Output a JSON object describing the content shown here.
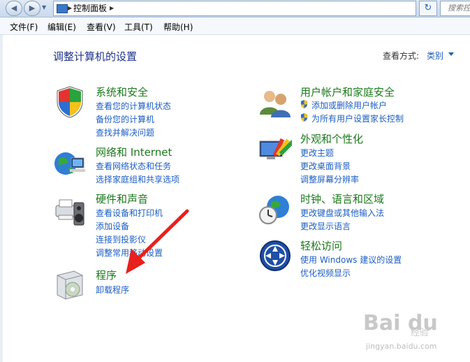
{
  "address": {
    "crumb": "控制面板",
    "search_placeholder": "搜索控"
  },
  "menu": [
    "文件(F)",
    "编辑(E)",
    "查看(V)",
    "工具(T)",
    "帮助(H)"
  ],
  "page": {
    "title": "调整计算机的设置",
    "view_by_label": "查看方式:",
    "view_by_value": "类别"
  },
  "categories_left": [
    {
      "title": "系统和安全",
      "links": [
        "查看您的计算机状态",
        "备份您的计算机",
        "查找并解决问题"
      ]
    },
    {
      "title": "网络和 Internet",
      "links": [
        "查看网络状态和任务",
        "选择家庭组和共享选项"
      ]
    },
    {
      "title": "硬件和声音",
      "links": [
        "查看设备和打印机",
        "添加设备",
        "连接到投影仪",
        "调整常用移动设置"
      ]
    },
    {
      "title": "程序",
      "links": [
        "卸载程序"
      ]
    }
  ],
  "categories_right": [
    {
      "title": "用户帐户和家庭安全",
      "links": [
        "添加或删除用户帐户",
        "为所有用户设置家长控制"
      ]
    },
    {
      "title": "外观和个性化",
      "links": [
        "更改主题",
        "更改桌面背景",
        "调整屏幕分辨率"
      ]
    },
    {
      "title": "时钟、语言和区域",
      "links": [
        "更改键盘或其他输入法",
        "更改显示语言"
      ]
    },
    {
      "title": "轻松访问",
      "links": [
        "使用 Windows 建议的设置",
        "优化视频显示"
      ]
    }
  ],
  "watermark": {
    "logo": "Bai du",
    "text": "经验",
    "url": "jingyan.baidu.com"
  },
  "colors": {
    "title": "#1e3287",
    "category": "#1b7a1b",
    "link": "#1c5ec2",
    "annotation_arrow": "#e8211d"
  }
}
